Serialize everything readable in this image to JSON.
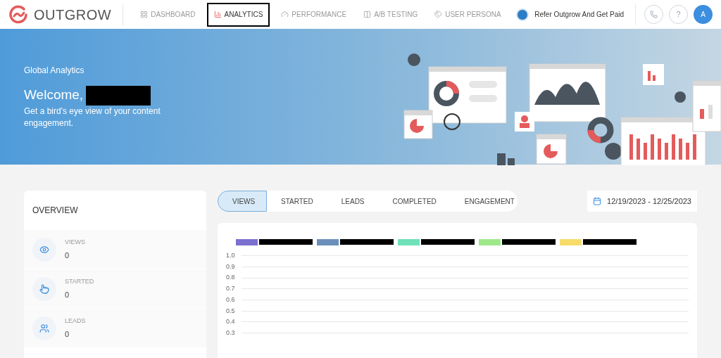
{
  "brand": {
    "name": "OUTGROW"
  },
  "nav": [
    {
      "label": "DASHBOARD",
      "selected": false
    },
    {
      "label": "ANALYTICS",
      "selected": true
    },
    {
      "label": "PERFORMANCE",
      "selected": false
    },
    {
      "label": "A/B TESTING",
      "selected": false
    },
    {
      "label": "USER PERSONA",
      "selected": false
    }
  ],
  "refer": {
    "label": "Refer Outgrow And Get Paid"
  },
  "header_buttons": [
    {
      "kind": "phone"
    },
    {
      "kind": "help",
      "label": "?"
    },
    {
      "kind": "avatar",
      "label": "A"
    }
  ],
  "banner": {
    "eyebrow": "Global Analytics",
    "greeting": "Welcome,",
    "subtitle": "Get a bird's eye view of your content engagement."
  },
  "overview": {
    "title": "OVERVIEW",
    "items": [
      {
        "label": "VIEWS",
        "value": "0"
      },
      {
        "label": "STARTED",
        "value": "0"
      },
      {
        "label": "LEADS",
        "value": "0"
      }
    ]
  },
  "tabs": [
    {
      "label": "VIEWS",
      "selected": true
    },
    {
      "label": "STARTED",
      "selected": false
    },
    {
      "label": "LEADS",
      "selected": false
    },
    {
      "label": "COMPLETED",
      "selected": false
    },
    {
      "label": "ENGAGEMENT",
      "selected": false
    }
  ],
  "date_range": "12/19/2023 - 12/25/2023",
  "legend": [
    {
      "color": "#7b6fd0"
    },
    {
      "color": "#6b8fbb"
    },
    {
      "color": "#6fe0b8"
    },
    {
      "color": "#9ee88a"
    },
    {
      "color": "#f6dc6a"
    }
  ],
  "chart": {
    "y_axis_labels": [
      "1.0",
      "0.9",
      "0.8",
      "0.7",
      "0.6",
      "0.5",
      "0.4",
      "0.3"
    ]
  }
}
